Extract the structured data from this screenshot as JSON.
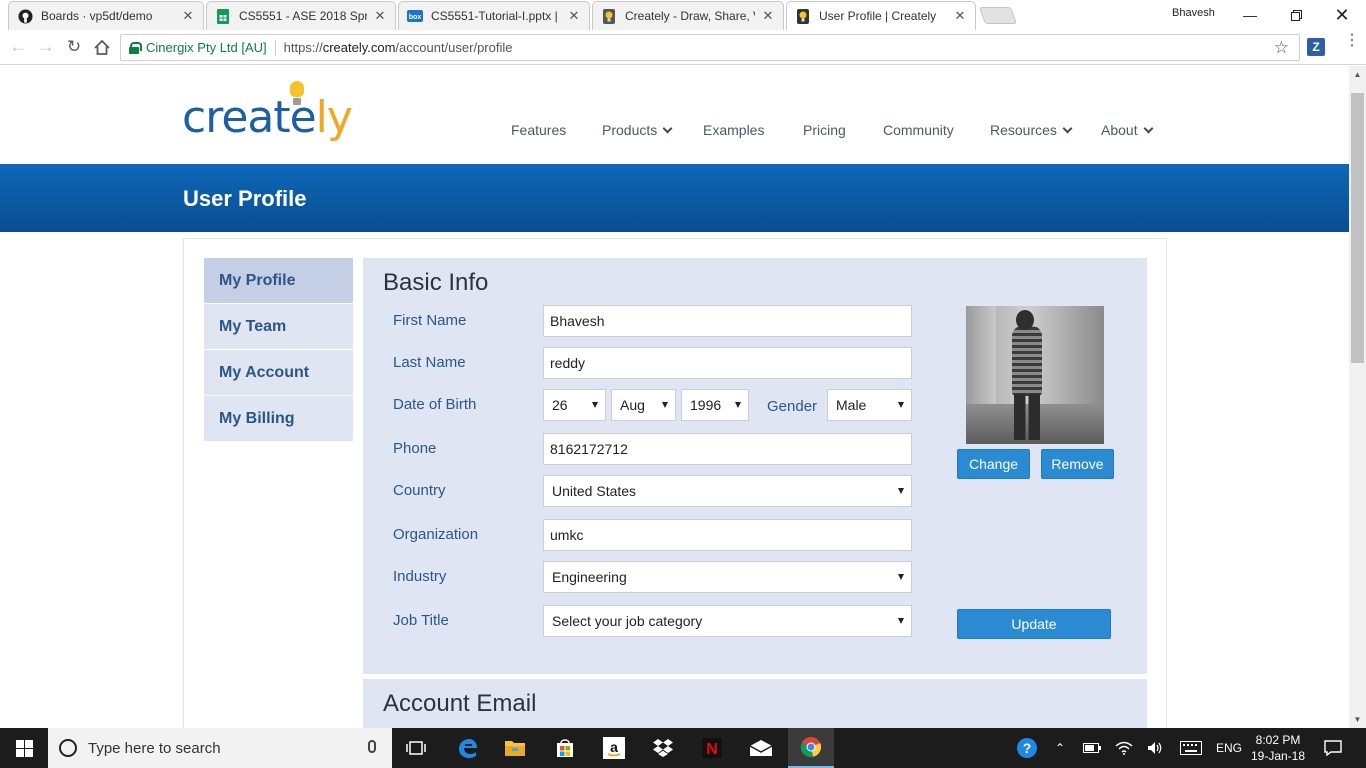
{
  "browser": {
    "tabs": [
      {
        "title": "Boards · vp5dt/demo",
        "icon": "github-icon"
      },
      {
        "title": "CS5551 - ASE 2018 Sprin",
        "icon": "sheets-icon"
      },
      {
        "title": "CS5551-Tutorial-I.pptx | B",
        "icon": "box-icon"
      },
      {
        "title": "Creately - Draw, Share, V",
        "icon": "creately-bulb-icon"
      },
      {
        "title": "User Profile | Creately",
        "icon": "creately-bulb-icon"
      }
    ],
    "profile_name": "Bhavesh",
    "secure_org": "Cinergix Pty Ltd [AU]",
    "url_scheme": "https://",
    "url_host": "creately.com",
    "url_path": "/account/user/profile",
    "extension_label": "Z"
  },
  "site": {
    "logo_main": "create",
    "logo_accent": "ly",
    "nav": [
      "Features",
      "Products",
      "Examples",
      "Pricing",
      "Community",
      "Resources",
      "About"
    ],
    "page_title": "User Profile"
  },
  "sidebar": {
    "items": [
      "My Profile",
      "My Team",
      "My Account",
      "My Billing"
    ],
    "active": "My Profile"
  },
  "basic_info": {
    "title": "Basic Info",
    "labels": {
      "first_name": "First Name",
      "last_name": "Last Name",
      "dob": "Date of Birth",
      "gender": "Gender",
      "phone": "Phone",
      "country": "Country",
      "organization": "Organization",
      "industry": "Industry",
      "job_title": "Job Title"
    },
    "values": {
      "first_name": "Bhavesh",
      "last_name": "reddy",
      "dob_day": "26",
      "dob_month": "Aug",
      "dob_year": "1996",
      "gender": "Male",
      "phone": "8162172712",
      "country": "United States",
      "organization": "umkc",
      "industry": "Engineering",
      "job_title": "Select your job category"
    },
    "buttons": {
      "change": "Change",
      "remove": "Remove",
      "update": "Update"
    }
  },
  "account_email": {
    "title": "Account Email"
  },
  "taskbar": {
    "search_placeholder": "Type here to search",
    "language": "ENG",
    "time": "8:02 PM",
    "date": "19-Jan-18"
  },
  "colors": {
    "brand_blue": "#1d5fa3",
    "brand_orange": "#f2a722",
    "banner": "#0b5aa6",
    "button": "#2a8bd3",
    "card_bg": "#dfe5f3"
  }
}
